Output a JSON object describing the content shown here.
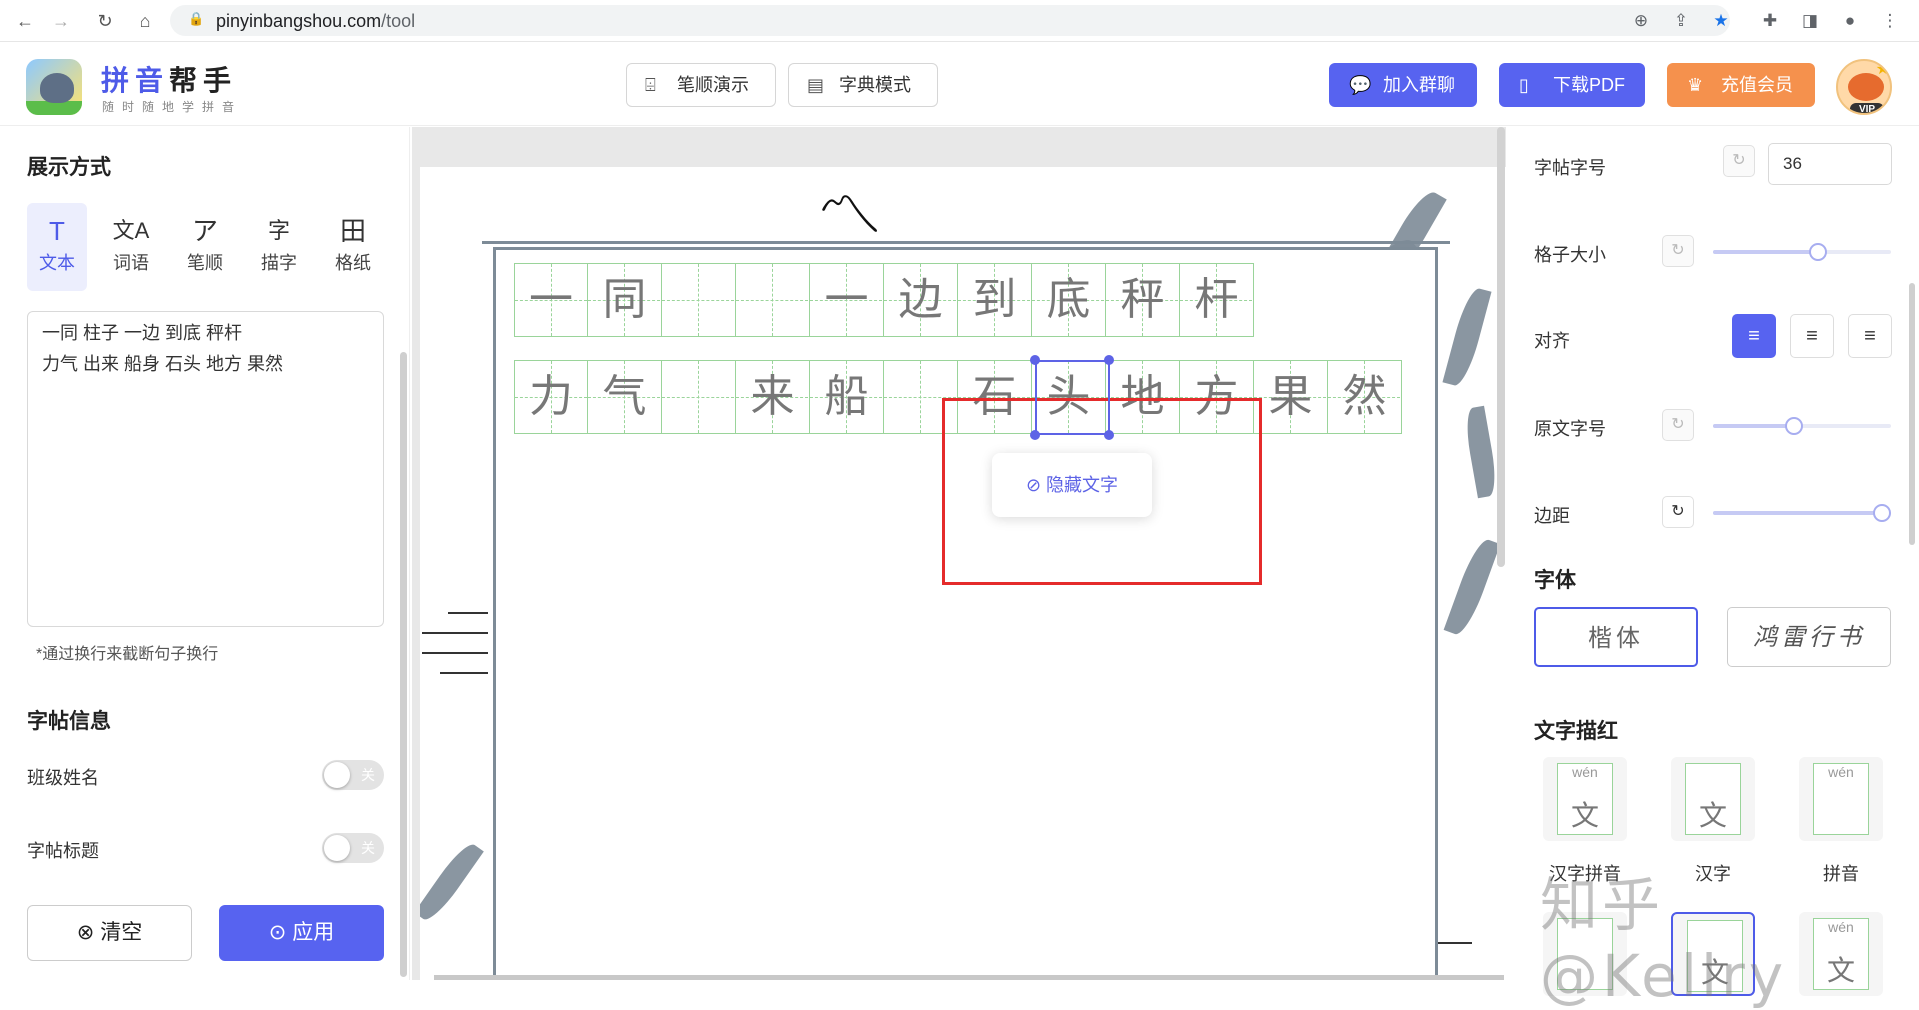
{
  "browser": {
    "url_host": "pinyinbangshou.com",
    "url_path": "/tool"
  },
  "header": {
    "logo_title_a": "拼音",
    "logo_title_b": "帮手",
    "logo_subtitle": "随时随地学拼音",
    "btn_stroke_demo": "笔顺演示",
    "btn_dict_mode": "字典模式",
    "btn_join_group": "加入群聊",
    "btn_download_pdf": "下载PDF",
    "btn_vip": "充值会员",
    "avatar_badge": "VIP"
  },
  "left": {
    "display_title": "展示方式",
    "modes": [
      {
        "icon": "T",
        "label": "文本"
      },
      {
        "icon": "文A",
        "label": "词语"
      },
      {
        "icon": "ア",
        "label": "笔顺"
      },
      {
        "icon": "字",
        "label": "描字"
      },
      {
        "icon": "田",
        "label": "格纸"
      }
    ],
    "textarea_value": "一同 柱子 一边 到底 秤杆\n力气 出来 船身 石头 地方 果然",
    "hint": "*通过换行来截断句子换行",
    "info_title": "字帖信息",
    "class_name_label": "班级姓名",
    "class_name_state": "关",
    "sheet_title_label": "字帖标题",
    "sheet_title_state": "关",
    "clear_label": "清空",
    "apply_label": "应用"
  },
  "canvas": {
    "row1": [
      "一",
      "同",
      "",
      "",
      "一",
      "边",
      "到",
      "底",
      "秤",
      "杆"
    ],
    "row2": [
      "力",
      "气",
      "",
      "来",
      "船",
      "",
      "石",
      "头",
      "地",
      "方",
      "果",
      "然"
    ],
    "popup_label": "隐藏文字"
  },
  "right": {
    "font_size_label": "字帖字号",
    "font_size_value": "36",
    "grid_size_label": "格子大小",
    "grid_size_value": 0.6,
    "align_label": "对齐",
    "align_selected": "left",
    "orig_size_label": "原文字号",
    "orig_size_value": 0.45,
    "margin_label": "边距",
    "margin_value": 1.0,
    "font_title": "字体",
    "font_options": [
      "楷体",
      "鸿雷行书"
    ],
    "trace_title": "文字描红",
    "trace_options": [
      {
        "label": "汉字拼音",
        "py": "wén",
        "hz": "文"
      },
      {
        "label": "汉字",
        "py": "",
        "hz": "文"
      },
      {
        "label": "拼音",
        "py": "wén",
        "hz": ""
      }
    ],
    "trace_row2": [
      {
        "py": "",
        "hz": ""
      },
      {
        "py": "",
        "hz": "文"
      },
      {
        "py": "wén",
        "hz": "文"
      }
    ]
  },
  "watermark": "知乎 @Kellry",
  "colors": {
    "primary": "#5763f0",
    "orange": "#f5914d",
    "red_box": "#e52b2b",
    "grid_green": "#9ad49a"
  }
}
